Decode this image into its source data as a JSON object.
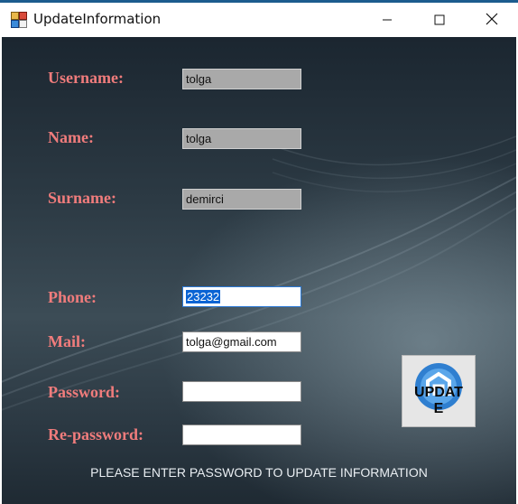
{
  "window": {
    "title": "UpdateInformation",
    "icon": "app-window-icon"
  },
  "titlebar_buttons": {
    "minimize_icon": "minimize-icon",
    "maximize_icon": "maximize-icon",
    "close_icon": "close-icon"
  },
  "form": {
    "username": {
      "label": "Username:",
      "value": "tolga"
    },
    "name": {
      "label": "Name:",
      "value": "tolga"
    },
    "surname": {
      "label": "Surname:",
      "value": "demirci"
    },
    "phone": {
      "label": "Phone:",
      "value": "23232"
    },
    "mail": {
      "label": "Mail:",
      "value": "tolga@gmail.com"
    },
    "password": {
      "label": "Password:",
      "value": ""
    },
    "repassword": {
      "label": "Re-password:",
      "value": ""
    }
  },
  "update_button": {
    "label": "UPDATE",
    "icon": "update-logo-icon"
  },
  "footer": {
    "message": "PLEASE ENTER PASSWORD TO UPDATE INFORMATION"
  },
  "colors": {
    "label": "#f07c7c",
    "readonly_field": "#a9a9a9",
    "selection": "#0a64d4",
    "accent": "#1c5c8e"
  }
}
